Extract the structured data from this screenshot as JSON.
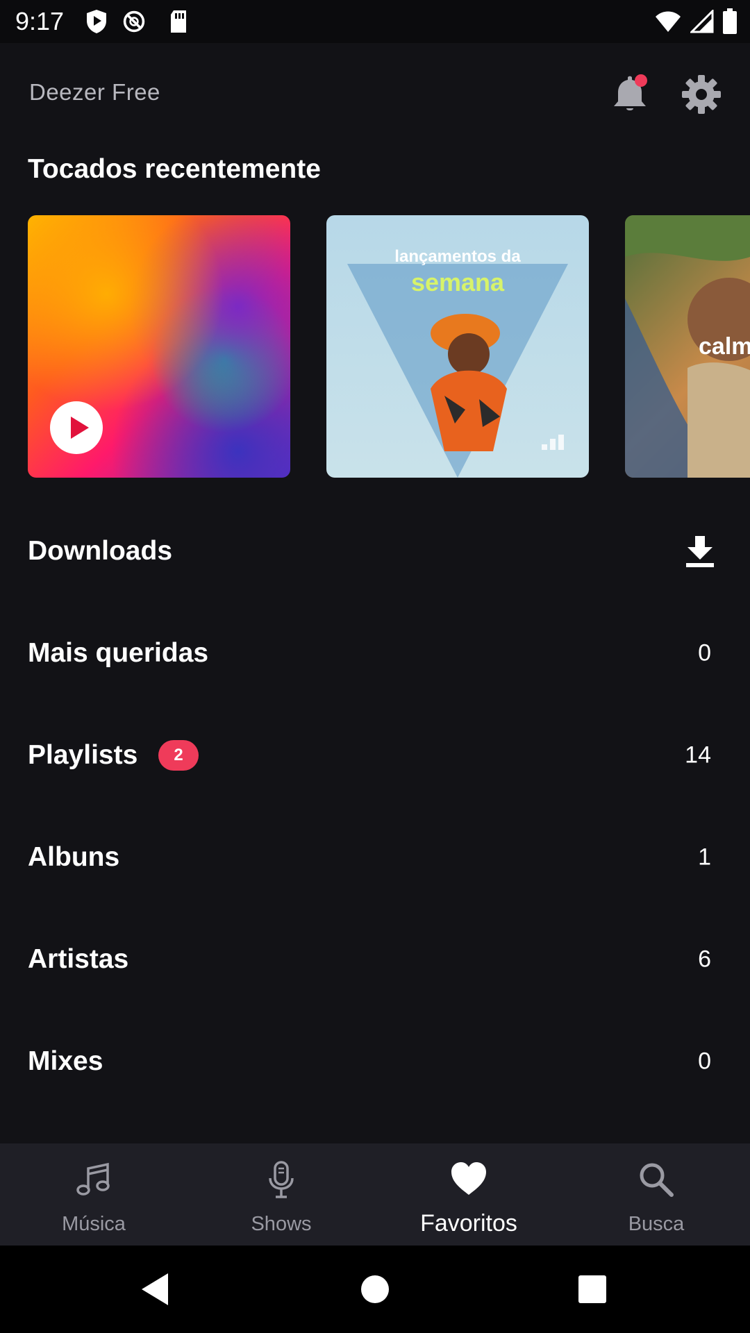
{
  "status_bar": {
    "time": "9:17"
  },
  "header": {
    "app_title": "Deezer Free",
    "notification_dot_color": "#ef3b5a"
  },
  "recent": {
    "title": "Tocados recentemente",
    "cards": [
      {
        "kind": "flow",
        "art": "gradient-flow"
      },
      {
        "title_line1": "lançamentos da",
        "title_line2": "semana"
      },
      {
        "partial_text": "calm"
      }
    ]
  },
  "library": {
    "rows": [
      {
        "label": "Downloads",
        "icon": "download-icon"
      },
      {
        "label": "Mais queridas",
        "count": "0"
      },
      {
        "label": "Playlists",
        "badge": "2",
        "count": "14"
      },
      {
        "label": "Albuns",
        "count": "1"
      },
      {
        "label": "Artistas",
        "count": "6"
      },
      {
        "label": "Mixes",
        "count": "0"
      }
    ]
  },
  "bottom_nav": {
    "items": [
      {
        "label": "Música",
        "icon": "music-note-icon"
      },
      {
        "label": "Shows",
        "icon": "microphone-icon"
      },
      {
        "label": "Favoritos",
        "icon": "heart-icon",
        "active": true
      },
      {
        "label": "Busca",
        "icon": "search-icon"
      }
    ]
  },
  "colors": {
    "background": "#121216",
    "nav_background": "#1f1f26",
    "accent_badge": "#ef3b5a",
    "inactive_text": "#9a9aa3"
  }
}
